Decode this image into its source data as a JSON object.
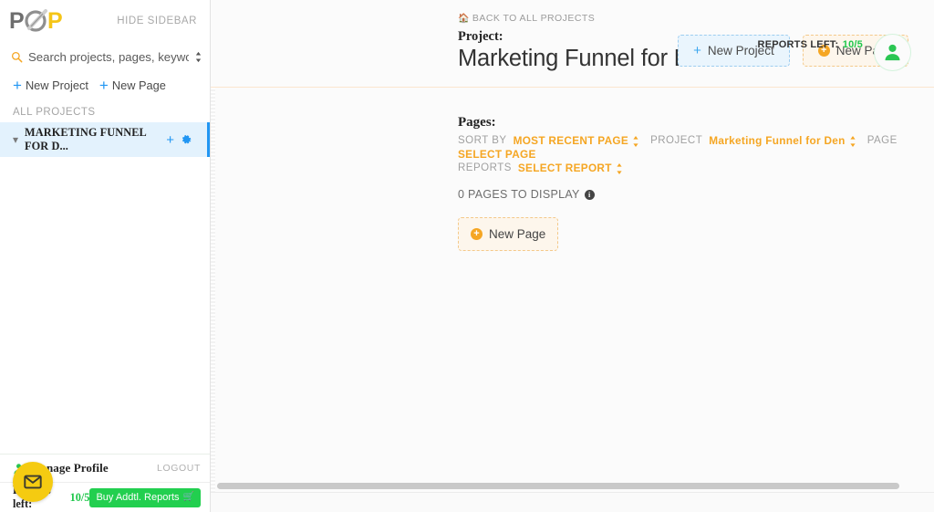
{
  "sidebar": {
    "logo_alt": "POP logo",
    "hide_sidebar": "HIDE SIDEBAR",
    "search": {
      "placeholder": "Search projects, pages, keywords...",
      "value": ""
    },
    "new_project_link": "New Project",
    "new_page_link": "New Page",
    "all_projects_label": "ALL PROJECTS",
    "projects": [
      {
        "name": "MARKETING FUNNEL FOR D..."
      }
    ],
    "profile": {
      "manage_profile": "Manage Profile",
      "logout": "LOGOUT",
      "reports_left_label": "Reports left:",
      "reports_left_value": "10/5",
      "buy_button": "Buy Addtl. Reports"
    }
  },
  "header": {
    "breadcrumb": "BACK TO ALL PROJECTS",
    "project_label": "Project:",
    "project_title": "Marketing Funnel for Dentist",
    "new_project_button": "New Project",
    "new_page_button": "New Page",
    "reports_left_label": "REPORTS LEFT:",
    "reports_left_value": "10/5"
  },
  "main": {
    "pages_title": "Pages:",
    "filters": {
      "sort_by_key": "SORT BY",
      "sort_by_value": "MOST RECENT PAGE",
      "project_key": "PROJECT",
      "project_value": "Marketing Funnel for Den",
      "page_key": "PAGE",
      "page_value": "SELECT PAGE",
      "reports_key": "REPORTS",
      "reports_value": "SELECT REPORT"
    },
    "pages_count_text": "0 PAGES TO DISPLAY",
    "new_page_button": "New Page"
  },
  "colors": {
    "accent_orange": "#f5a623",
    "accent_blue": "#2196f3",
    "accent_green": "#22cf4f",
    "logo_yellow": "#f5c518",
    "fab_yellow": "#f5cb11"
  }
}
